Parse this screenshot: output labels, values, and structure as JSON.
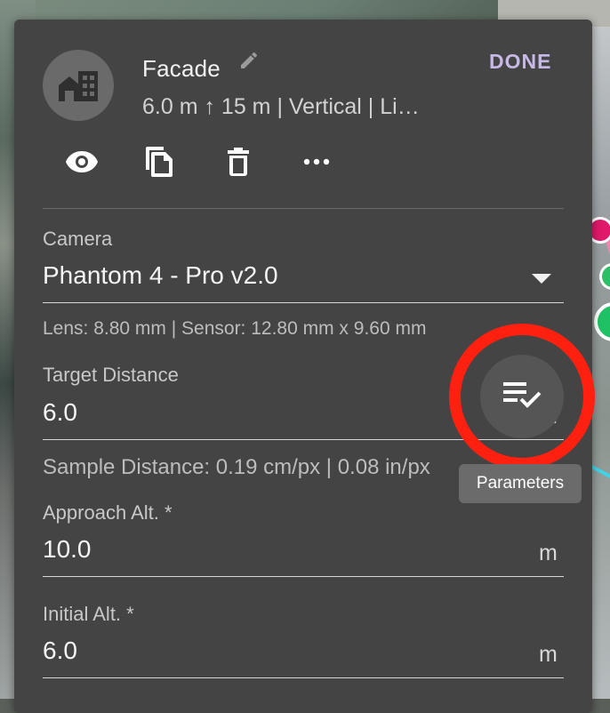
{
  "header": {
    "title": "Facade",
    "subtitle": "6.0 m ↑ 15 m | Vertical | Li…",
    "done_label": "DONE",
    "accent_color": "#c7b8e6"
  },
  "icons": {
    "avatar": "building-icon",
    "edit": "pencil-icon",
    "actions": [
      "eye-icon",
      "copy-icon",
      "trash-icon",
      "more-icon"
    ],
    "fab": "checklist-icon"
  },
  "camera": {
    "label": "Camera",
    "value": "Phantom 4 - Pro v2.0",
    "helper": "Lens: 8.80 mm | Sensor: 12.80 mm x 9.60 mm"
  },
  "target_distance": {
    "label": "Target Distance",
    "value": "6.0",
    "unit": "m",
    "helper": "Sample Distance: 0.19 cm/px | 0.08 in/px"
  },
  "approach_alt": {
    "label": "Approach Alt. *",
    "value": "10.0",
    "unit": "m"
  },
  "initial_alt": {
    "label": "Initial Alt. *",
    "value": "6.0",
    "unit": "m"
  },
  "tooltip": {
    "text": "Parameters"
  },
  "highlight_color": "#ff2010"
}
